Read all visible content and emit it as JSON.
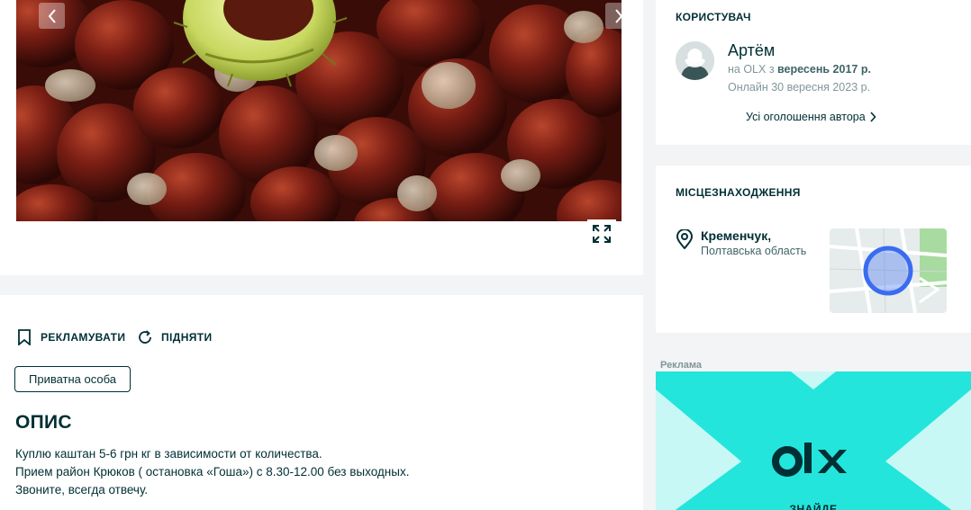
{
  "gallery": {
    "prev_icon": "chevron-left-icon",
    "next_icon": "chevron-right-icon",
    "expand_icon": "expand-icon"
  },
  "actions": {
    "promote_label": "РЕКЛАМУВАТИ",
    "raise_label": "ПІДНЯТИ"
  },
  "seller_type": "Приватна особа",
  "description": {
    "title": "ОПИС",
    "lines": [
      "Куплю каштан 5-6 грн кг в зависимости от количества.",
      "Прием район Крюков ( остановка «Гоша») с 8.30-12.00 без выходных.",
      "Звоните, всегда отвечу."
    ]
  },
  "user": {
    "section_title": "КОРИСТУВАЧ",
    "name": "Артём",
    "since_prefix": "на OLX з",
    "since_value": "вересень 2017 р.",
    "online": "Онлайн 30 вересня 2023 р.",
    "all_ads_label": "Усі оголошення автора"
  },
  "location": {
    "section_title": "МІСЦЕЗНАХОДЖЕННЯ",
    "city": "Кременчук,",
    "region": "Полтавська область"
  },
  "ad": {
    "label": "Реклама",
    "logo_text": "OLX",
    "tagline": "ЗНАЙДЕ"
  },
  "colors": {
    "text": "#002f34",
    "muted": "#7f9799",
    "ad_teal": "#23e5db",
    "ad_light": "#c8f8f6",
    "map_pin": "#3a6cf0"
  }
}
